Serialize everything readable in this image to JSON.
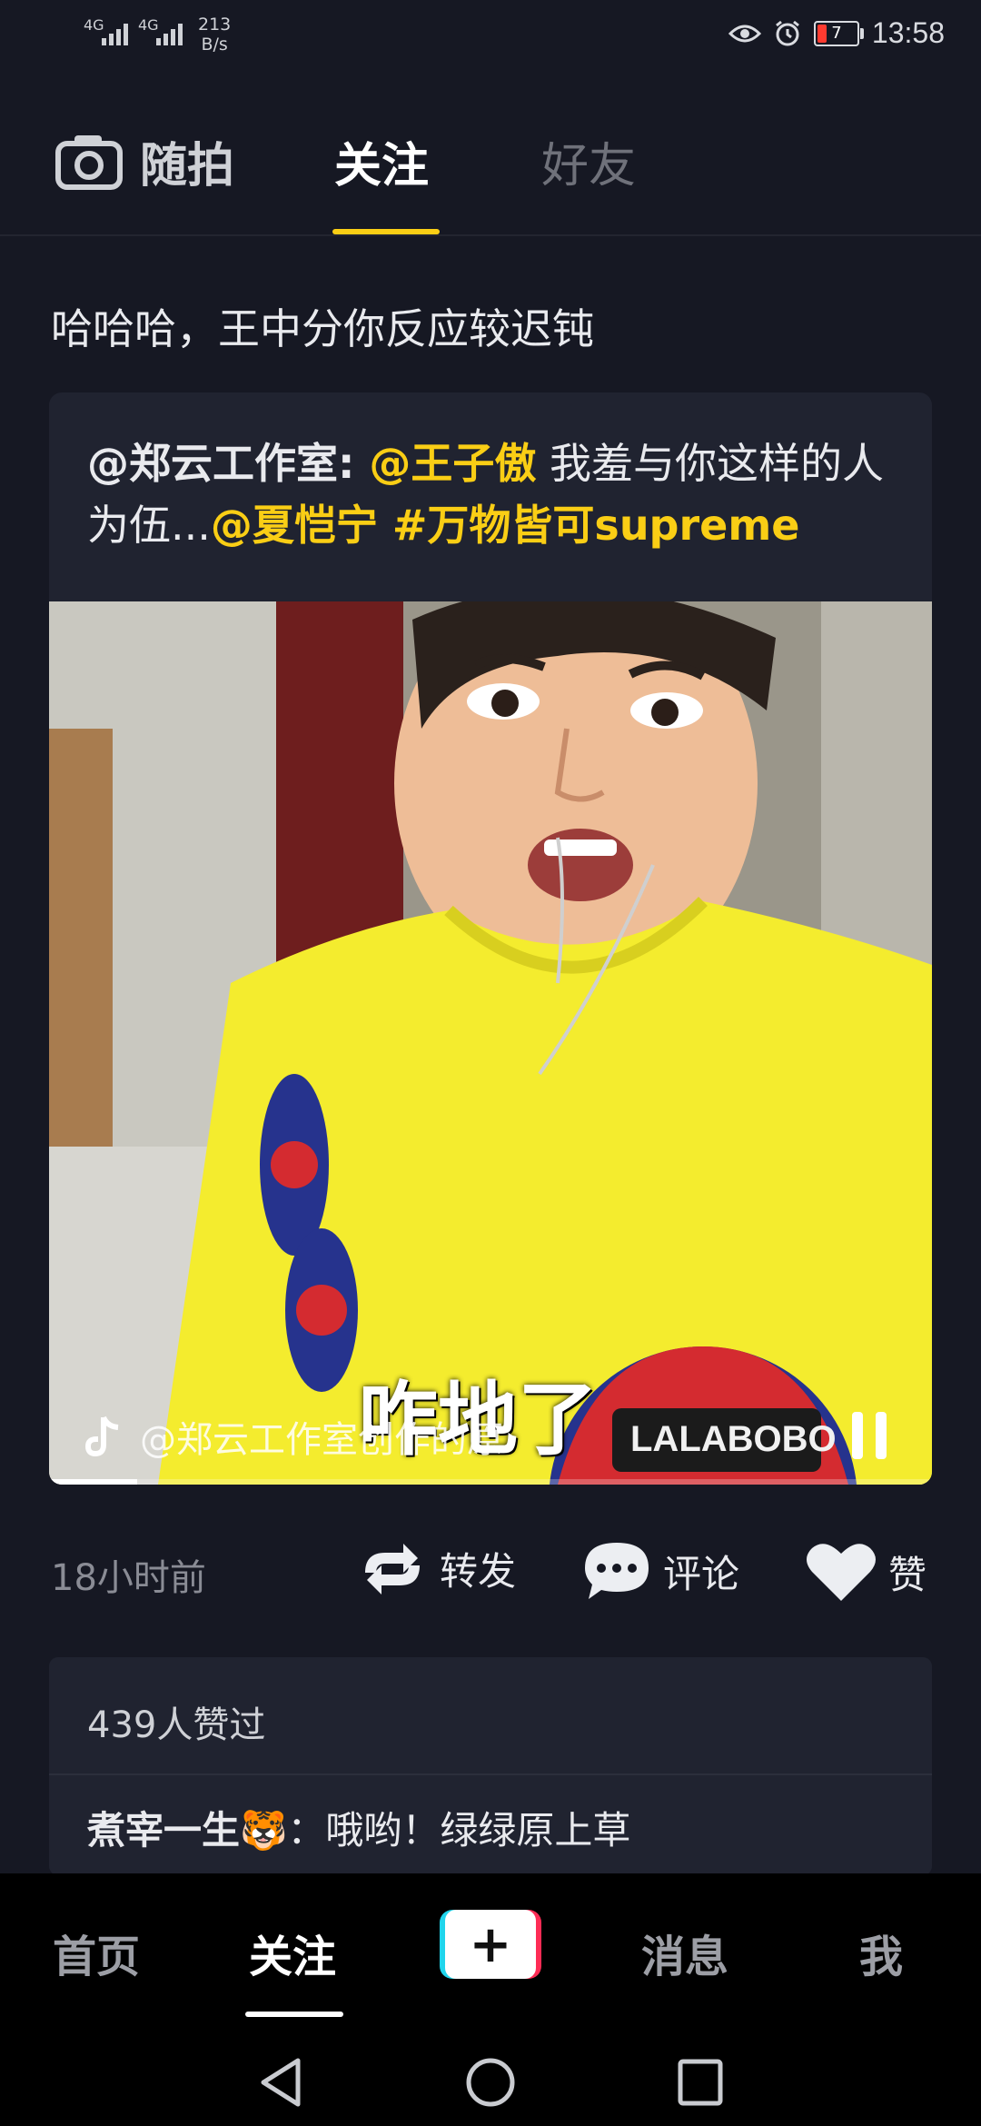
{
  "status_bar": {
    "network_1": "4G",
    "network_2": "4G",
    "speed_value": "213",
    "speed_unit": "B/s",
    "battery_level": "7",
    "time": "13:58"
  },
  "top_tabs": {
    "quick_shot": "随拍",
    "follow": "关注",
    "friends": "好友",
    "active": "关注"
  },
  "post": {
    "text": "哈哈哈，王中分你反应较迟钝",
    "quoted": {
      "author": "@郑云工作室:",
      "mention_1": "@王子傲",
      "text_1": " 我羞与你这样的人为伍...",
      "mention_2": "@夏恺宁",
      "hashtag": "#万物皆可supreme",
      "video": {
        "subtitle": "咋地了",
        "watermark": "@郑云工作室创作的原",
        "progress": 0.1,
        "shirt_text": "LALABOBO"
      }
    },
    "time_ago": "18小时前",
    "actions": {
      "repost": "转发",
      "comment": "评论",
      "like": "赞"
    }
  },
  "likes": {
    "count_text": "439人赞过",
    "comment": {
      "author": "煮宰一生",
      "separator": "：",
      "text": "哦哟！绿绿原上草"
    }
  },
  "bottom_nav": {
    "home": "首页",
    "follow": "关注",
    "messages": "消息",
    "me": "我",
    "active": "关注"
  },
  "colors": {
    "accent": "#face15",
    "background": "#161823",
    "card": "#202330"
  }
}
